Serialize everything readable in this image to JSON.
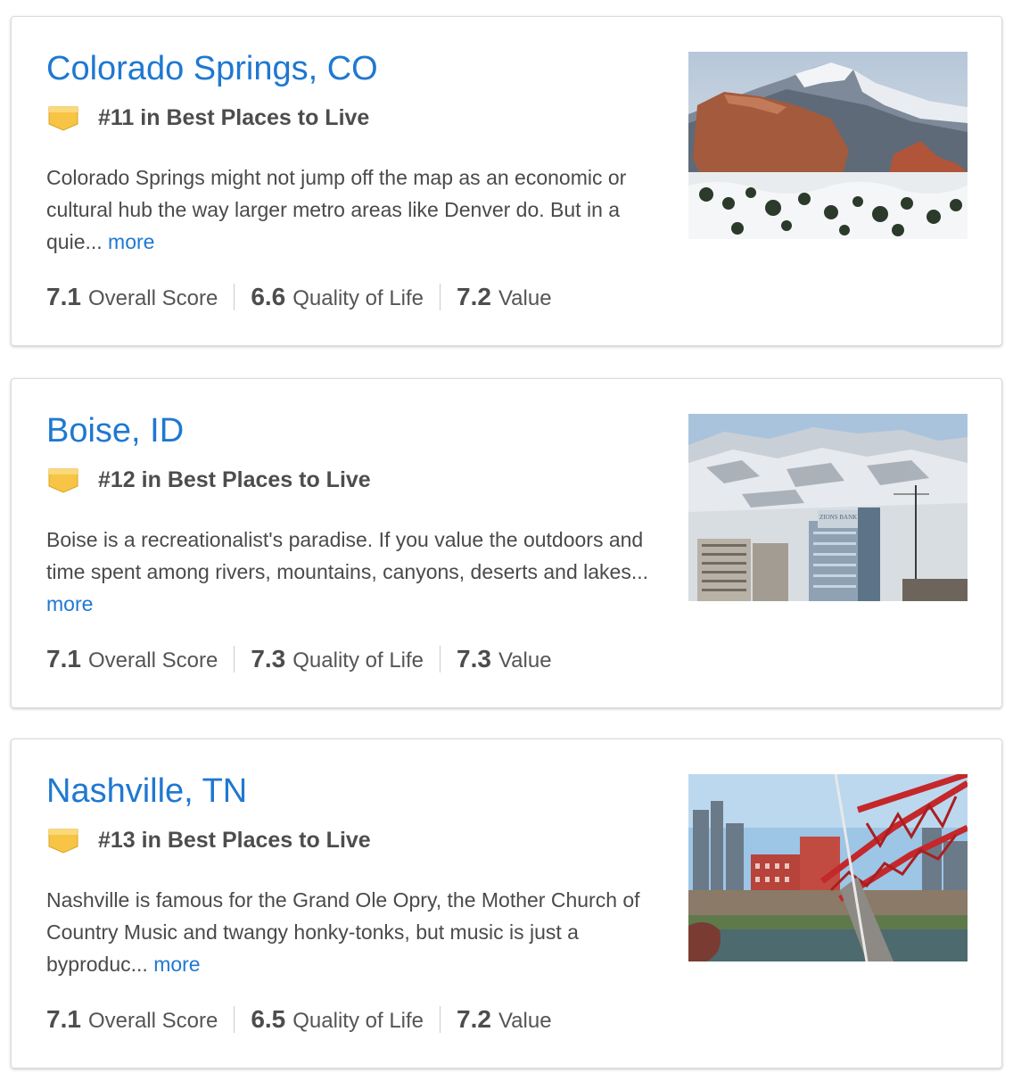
{
  "colors": {
    "link": "#1f78d1",
    "text": "#4a4a4a",
    "badge": "#f5c242"
  },
  "places": [
    {
      "title": "Colorado Springs, CO",
      "rank": "#11 in Best Places to Live",
      "description": "Colorado Springs might not jump off the map as an economic or cultural hub the way larger metro areas like Denver do. But in a quie...",
      "more": "more",
      "scores": [
        {
          "value": "7.1",
          "label": "Overall Score"
        },
        {
          "value": "6.6",
          "label": "Quality of Life"
        },
        {
          "value": "7.2",
          "label": "Value"
        }
      ],
      "image_icon": "mountain-photo"
    },
    {
      "title": "Boise, ID",
      "rank": "#12 in Best Places to Live",
      "description": "Boise is a recreationalist's paradise. If you value the outdoors and time spent among rivers, mountains, canyons, deserts and lakes...",
      "more": "more",
      "scores": [
        {
          "value": "7.1",
          "label": "Overall Score"
        },
        {
          "value": "7.3",
          "label": "Quality of Life"
        },
        {
          "value": "7.3",
          "label": "Value"
        }
      ],
      "image_icon": "city-snow-mountains-photo",
      "image_text": "ZIONS BANK"
    },
    {
      "title": "Nashville, TN",
      "rank": "#13 in Best Places to Live",
      "description": "Nashville is famous for the Grand Ole Opry, the Mother Church of Country Music and twangy honky-tonks, but music is just a byproduc...",
      "more": "more",
      "scores": [
        {
          "value": "7.1",
          "label": "Overall Score"
        },
        {
          "value": "6.5",
          "label": "Quality of Life"
        },
        {
          "value": "7.2",
          "label": "Value"
        }
      ],
      "image_icon": "riverfront-bridge-photo"
    }
  ]
}
